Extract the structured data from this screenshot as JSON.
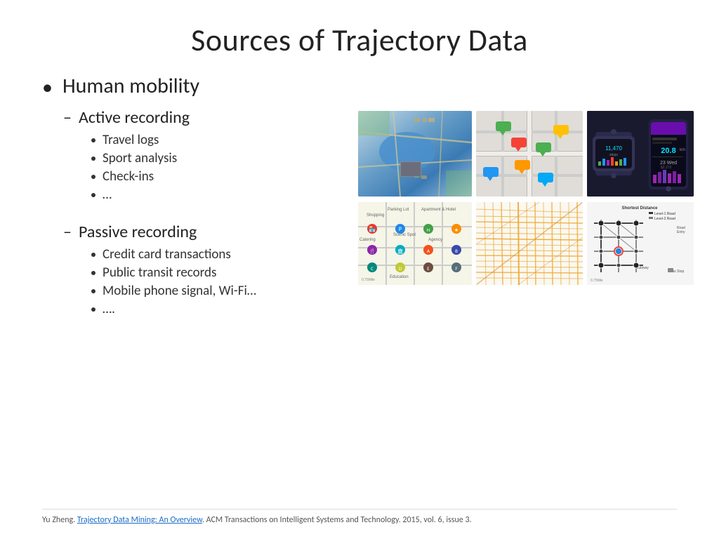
{
  "title": "Sources of Trajectory Data",
  "main_bullet": "Human mobility",
  "active_recording": {
    "label": "Active recording",
    "items": [
      "Travel logs",
      "Sport analysis",
      "Check-ins",
      "…"
    ]
  },
  "passive_recording": {
    "label": "Passive recording",
    "items": [
      "Credit card transactions",
      "Public transit records",
      "Mobile phone signal, Wi-Fi…",
      "…."
    ]
  },
  "citation": {
    "author": "Yu Zheng. ",
    "link_text": "Trajectory Data Mining: An Overview",
    "rest": ". ACM Transactions on Intelligent Systems and Technology. 2015, vol. 6, issue 3."
  }
}
